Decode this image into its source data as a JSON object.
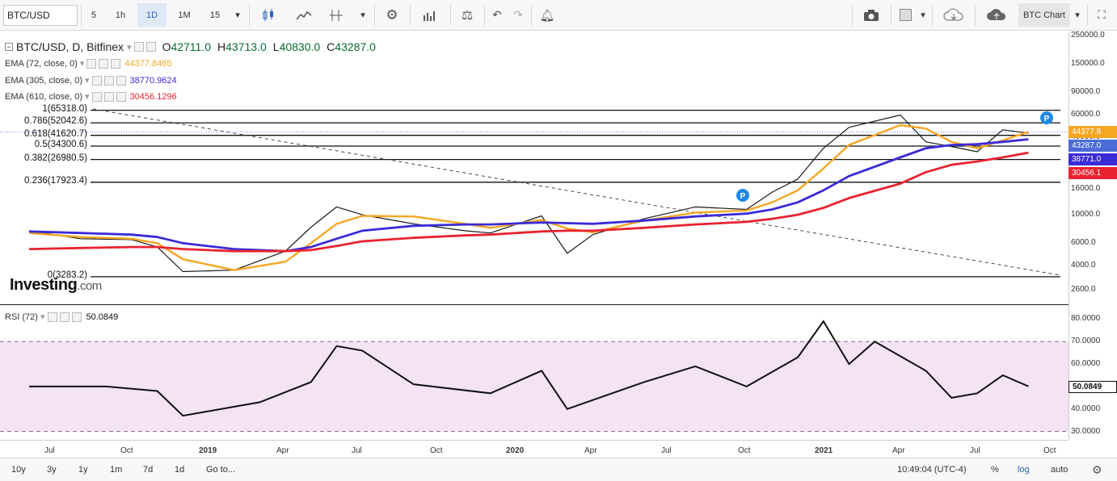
{
  "toolbar": {
    "symbol": "BTC/USD",
    "intervals": [
      "5",
      "1h",
      "1D",
      "1M",
      "15"
    ],
    "active_interval": "1D",
    "layout_label": "BTC Chart"
  },
  "legend": {
    "title": "BTC/USD, D, Bitfinex",
    "open_label": "O",
    "open": "42711.0",
    "high_label": "H",
    "high": "43713.0",
    "low_label": "L",
    "low": "40830.0",
    "close_label": "C",
    "close": "43287.0",
    "emas": [
      {
        "label": "EMA (72, close, 0)",
        "value": "44377.8465",
        "color": "#f5a623"
      },
      {
        "label": "EMA (305, close, 0)",
        "value": "38770.9624",
        "color": "#3b2bd6"
      },
      {
        "label": "EMA (610, close, 0)",
        "value": "30456.1296",
        "color": "#e8232f"
      }
    ]
  },
  "fib_levels": [
    {
      "label": "1(65318.0)",
      "price": 65318
    },
    {
      "label": "0.786(52042.6)",
      "price": 52042.6
    },
    {
      "label": "0.618(41620.7)",
      "price": 41620.7
    },
    {
      "label": "0.5(34300.6)",
      "price": 34300.6
    },
    {
      "label": "0.382(26980.5)",
      "price": 26980.5
    },
    {
      "label": "0.236(17923.4)",
      "price": 17923.4
    },
    {
      "label": "0(3283.2)",
      "price": 3283.2
    }
  ],
  "price_axis_labels": [
    "250000.0",
    "150000.0",
    "90000.0",
    "60000.0",
    "40000.0",
    "26000.0",
    "16000.0",
    "10000.0",
    "6000.0",
    "4000.0",
    "2600.0"
  ],
  "price_tags": [
    {
      "text": "44377.8",
      "color": "#f5a623",
      "price": 44377.8
    },
    {
      "text": "43287.0",
      "color": "#4a6bd8",
      "price": 43287
    },
    {
      "text": "38771.0",
      "color": "#3b2bd6",
      "price": 38771
    },
    {
      "text": "30456.1",
      "color": "#e8232f",
      "price": 30456.1
    }
  ],
  "rsi": {
    "label": "RSI (72)",
    "value": "50.0849",
    "axis_labels": [
      "80.0000",
      "70.0000",
      "60.0000",
      "50.0000",
      "40.0000",
      "30.0000"
    ],
    "band_color": "#f3e3f3"
  },
  "time_labels": [
    "Jul",
    "Oct",
    "2019",
    "Apr",
    "Jul",
    "Oct",
    "2020",
    "Apr",
    "Jul",
    "Oct",
    "2021",
    "Apr",
    "Jul",
    "Oct"
  ],
  "logo": {
    "brand": "Investing",
    "suffix": ".com"
  },
  "markers": [
    {
      "text": "P"
    },
    {
      "text": "P"
    }
  ],
  "bottom": {
    "ranges": [
      "10y",
      "3y",
      "1y",
      "1m",
      "7d",
      "1d"
    ],
    "goto": "Go to...",
    "clock": "10:49:04 (UTC-4)",
    "percent": "%",
    "log": "log",
    "auto": "auto"
  },
  "chart_data": {
    "type": "line",
    "scale": "log",
    "x": [
      "2018-06",
      "2018-08",
      "2018-10",
      "2018-11",
      "2018-12",
      "2019-02",
      "2019-04",
      "2019-05",
      "2019-06",
      "2019-07",
      "2019-09",
      "2019-11",
      "2019-12",
      "2020-02",
      "2020-03",
      "2020-04",
      "2020-06",
      "2020-08",
      "2020-10",
      "2020-11",
      "2020-12",
      "2021-01",
      "2021-02",
      "2021-04",
      "2021-05",
      "2021-06",
      "2021-07",
      "2021-08",
      "2021-09"
    ],
    "series": [
      {
        "name": "BTC/USD",
        "values": [
          7500,
          6500,
          6400,
          5600,
          3600,
          3700,
          5200,
          8000,
          11500,
          10000,
          8500,
          7500,
          7200,
          9800,
          5000,
          7000,
          9300,
          11500,
          11000,
          15000,
          19000,
          33000,
          48000,
          60000,
          37000,
          34000,
          31000,
          46000,
          43287
        ]
      },
      {
        "name": "EMA (72, close, 0)",
        "values": [
          7200,
          6700,
          6500,
          6000,
          4500,
          3700,
          4300,
          6000,
          8500,
          9800,
          9700,
          8500,
          7900,
          9100,
          7800,
          7300,
          9000,
          10400,
          10800,
          12500,
          15500,
          23000,
          35000,
          50000,
          47000,
          37000,
          33000,
          38000,
          44377.8
        ]
      },
      {
        "name": "EMA (305, close, 0)",
        "values": [
          7400,
          7200,
          7000,
          6700,
          6000,
          5400,
          5200,
          5600,
          6500,
          7500,
          8200,
          8400,
          8400,
          8700,
          8600,
          8500,
          9000,
          9700,
          10200,
          11000,
          12500,
          15500,
          20000,
          28000,
          33000,
          35000,
          35500,
          37000,
          38771
        ]
      },
      {
        "name": "EMA (610, close, 0)",
        "values": [
          5400,
          5500,
          5600,
          5600,
          5400,
          5200,
          5200,
          5300,
          5700,
          6200,
          6600,
          6900,
          7000,
          7400,
          7500,
          7500,
          7900,
          8400,
          8800,
          9300,
          10000,
          11300,
          13500,
          17500,
          21500,
          24500,
          26000,
          28000,
          30456.1
        ]
      }
    ],
    "ylim": [
      2600,
      250000
    ]
  },
  "rsi_data": {
    "x": [
      "2018-06",
      "2018-09",
      "2018-11",
      "2018-12",
      "2019-03",
      "2019-05",
      "2019-06",
      "2019-07",
      "2019-09",
      "2019-12",
      "2020-02",
      "2020-03",
      "2020-06",
      "2020-08",
      "2020-10",
      "2020-12",
      "2021-01",
      "2021-02",
      "2021-03",
      "2021-05",
      "2021-06",
      "2021-07",
      "2021-08",
      "2021-09"
    ],
    "values": [
      50,
      50,
      48,
      37,
      43,
      52,
      68,
      66,
      51,
      47,
      57,
      40,
      52,
      59,
      50,
      63,
      79,
      60,
      70,
      57,
      45,
      47,
      55,
      50.08
    ],
    "ylim": [
      27,
      83
    ]
  }
}
